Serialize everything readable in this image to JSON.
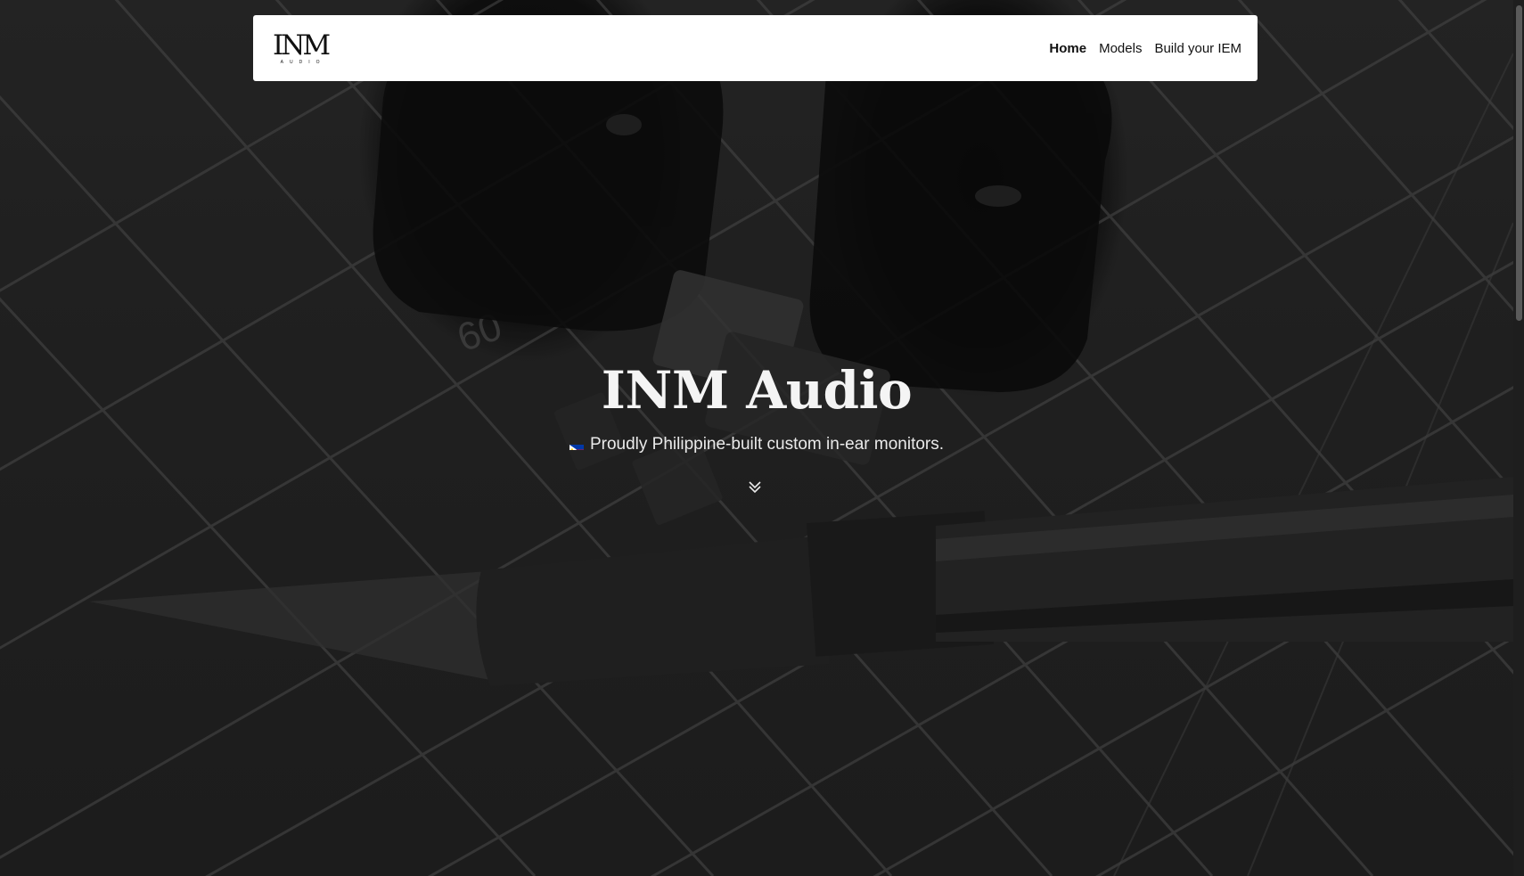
{
  "navbar": {
    "logo": {
      "word": "INM",
      "sub": "AUDIO"
    },
    "links": [
      {
        "label": "Home",
        "active": true
      },
      {
        "label": "Models",
        "active": false
      },
      {
        "label": "Build your IEM",
        "active": false
      }
    ]
  },
  "hero": {
    "title": "INM Audio",
    "subtitle": "Proudly Philippine-built custom in-ear monitors.",
    "flag_icon": "philippines-flag-icon",
    "scroll_icon": "double-chevron-down-icon"
  },
  "colors": {
    "navbar_bg": "#ffffff",
    "hero_text": "#f4f4f4",
    "page_bg": "#262626"
  }
}
